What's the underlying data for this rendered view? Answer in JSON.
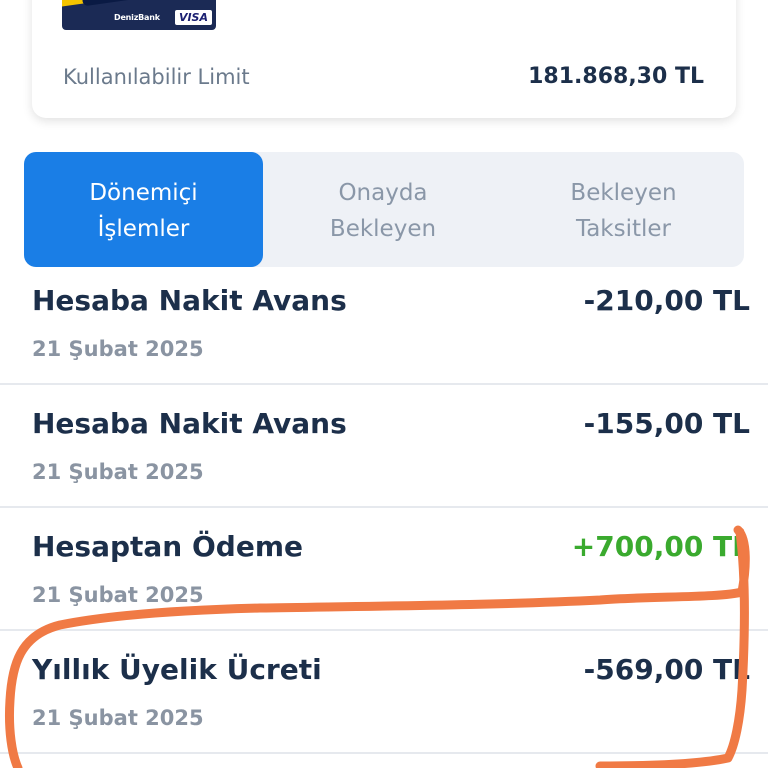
{
  "card": {
    "bank_name": "DenizBank",
    "network": "VISA",
    "limit_label": "Kullanılabilir Limit",
    "limit_value": "181.868,30 TL"
  },
  "tabs": [
    {
      "line1": "Dönemiçi",
      "line2": "İşlemler",
      "active": true
    },
    {
      "line1": "Onayda",
      "line2": "Bekleyen",
      "active": false
    },
    {
      "line1": "Bekleyen",
      "line2": "Taksitler",
      "active": false
    }
  ],
  "transactions": [
    {
      "title": "Hesaba Nakit Avans",
      "date": "21 Şubat 2025",
      "amount": "-210,00 TL",
      "positive": false
    },
    {
      "title": "Hesaba Nakit Avans",
      "date": "21 Şubat 2025",
      "amount": "-155,00 TL",
      "positive": false
    },
    {
      "title": "Hesaptan Ödeme",
      "date": "21 Şubat 2025",
      "amount": "+700,00 TL",
      "positive": true
    },
    {
      "title": "Yıllık Üyelik Ücreti",
      "date": "21 Şubat 2025",
      "amount": "-569,00 TL",
      "positive": false
    }
  ],
  "colors": {
    "accent": "#1a7ee6",
    "positive": "#3aaa2e",
    "annotation": "#f07a45",
    "card_yellow": "#f5c400",
    "card_navy": "#1b2a55"
  }
}
